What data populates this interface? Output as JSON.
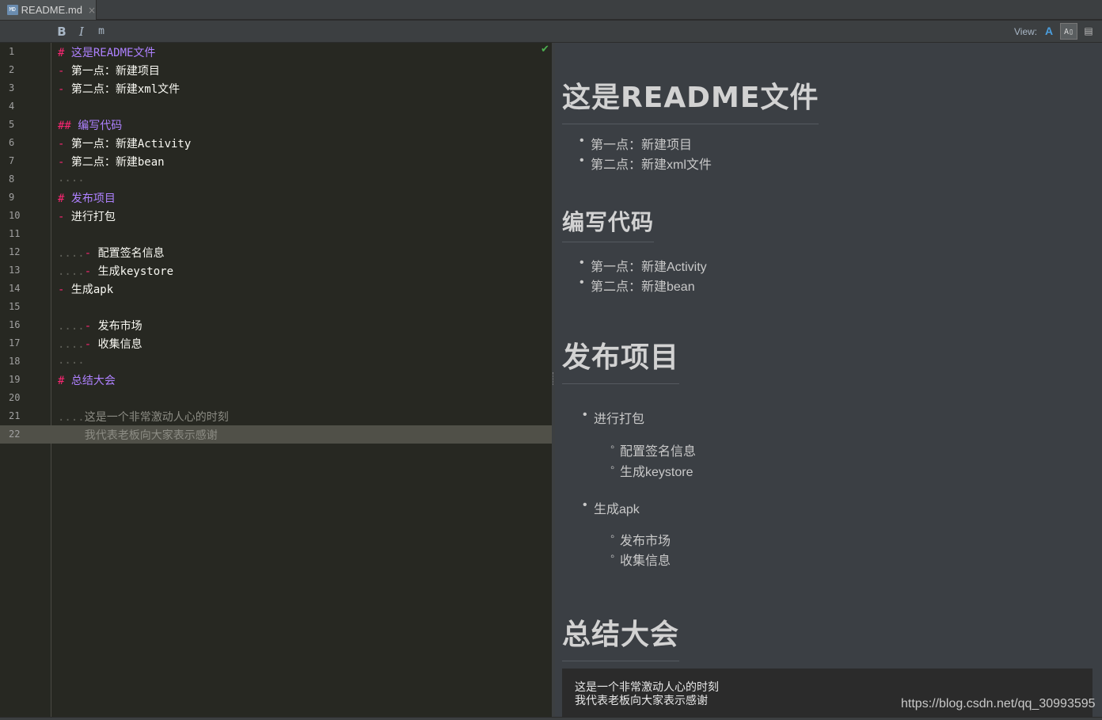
{
  "tab": {
    "icon": "markdown-file-icon",
    "label": "README.md",
    "close": "×"
  },
  "toolbar": {
    "bold": "B",
    "italic": "I",
    "code": "m",
    "view_label": "View:",
    "view_editor": "A",
    "view_split": "A▯",
    "view_preview": "▤"
  },
  "editor": {
    "lines": [
      {
        "n": "1",
        "parts": [
          [
            "hash",
            "# "
          ],
          [
            "htext",
            "这是README文件"
          ]
        ]
      },
      {
        "n": "2",
        "parts": [
          [
            "dash",
            "- "
          ],
          [
            "text",
            "第一点：新建项目"
          ]
        ]
      },
      {
        "n": "3",
        "parts": [
          [
            "dash",
            "- "
          ],
          [
            "text",
            "第二点：新建xml文件"
          ]
        ]
      },
      {
        "n": "4",
        "parts": []
      },
      {
        "n": "5",
        "parts": [
          [
            "hash",
            "## "
          ],
          [
            "htext",
            "编写代码"
          ]
        ]
      },
      {
        "n": "6",
        "parts": [
          [
            "dash",
            "- "
          ],
          [
            "text",
            "第一点：新建Activity"
          ]
        ]
      },
      {
        "n": "7",
        "parts": [
          [
            "dash",
            "- "
          ],
          [
            "text",
            "第二点：新建bean"
          ]
        ]
      },
      {
        "n": "8",
        "parts": [
          [
            "dots",
            "...."
          ]
        ]
      },
      {
        "n": "9",
        "parts": [
          [
            "hash",
            "# "
          ],
          [
            "htext",
            "发布项目"
          ]
        ]
      },
      {
        "n": "10",
        "parts": [
          [
            "dash",
            "- "
          ],
          [
            "text",
            "进行打包"
          ]
        ]
      },
      {
        "n": "11",
        "parts": []
      },
      {
        "n": "12",
        "parts": [
          [
            "dots",
            "...."
          ],
          [
            "dash",
            "- "
          ],
          [
            "text",
            "配置签名信息"
          ]
        ]
      },
      {
        "n": "13",
        "parts": [
          [
            "dots",
            "...."
          ],
          [
            "dash",
            "- "
          ],
          [
            "text",
            "生成keystore"
          ]
        ]
      },
      {
        "n": "14",
        "parts": [
          [
            "dash",
            "- "
          ],
          [
            "text",
            "生成apk"
          ]
        ]
      },
      {
        "n": "15",
        "parts": []
      },
      {
        "n": "16",
        "parts": [
          [
            "dots",
            "...."
          ],
          [
            "dash",
            "- "
          ],
          [
            "text",
            "发布市场"
          ]
        ]
      },
      {
        "n": "17",
        "parts": [
          [
            "dots",
            "...."
          ],
          [
            "dash",
            "- "
          ],
          [
            "text",
            "收集信息"
          ]
        ]
      },
      {
        "n": "18",
        "parts": [
          [
            "dots",
            "...."
          ]
        ]
      },
      {
        "n": "19",
        "parts": [
          [
            "hash",
            "# "
          ],
          [
            "htext",
            "总结大会"
          ]
        ]
      },
      {
        "n": "20",
        "parts": []
      },
      {
        "n": "21",
        "parts": [
          [
            "dots",
            "...."
          ],
          [
            "grey",
            "这是一个非常激动人心的时刻"
          ]
        ]
      },
      {
        "n": "22",
        "parts": [
          [
            "dots",
            "    "
          ],
          [
            "grey",
            "我代表老板向大家表示感谢"
          ]
        ]
      }
    ],
    "current_line": "22"
  },
  "preview": {
    "h1_readme": "这是README文件",
    "readme_items": [
      "第一点：新建项目",
      "第二点：新建xml文件"
    ],
    "h2_code": "编写代码",
    "code_items": [
      "第一点：新建Activity",
      "第二点：新建bean"
    ],
    "h1_publish": "发布项目",
    "publish_pack": "进行打包",
    "pack_sub": [
      "配置签名信息",
      "生成keystore"
    ],
    "publish_apk": "生成apk",
    "apk_sub": [
      "发布市场",
      "收集信息"
    ],
    "h1_summary": "总结大会",
    "codeblock": [
      "这是一个非常激动人心的时刻",
      "我代表老板向大家表示感谢"
    ]
  },
  "watermark": "https://blog.csdn.net/qq_30993595",
  "colors": {
    "heading": "#ae81ff",
    "marker": "#f92672",
    "check": "#4caf50",
    "view_accent": "#4a9ede"
  }
}
